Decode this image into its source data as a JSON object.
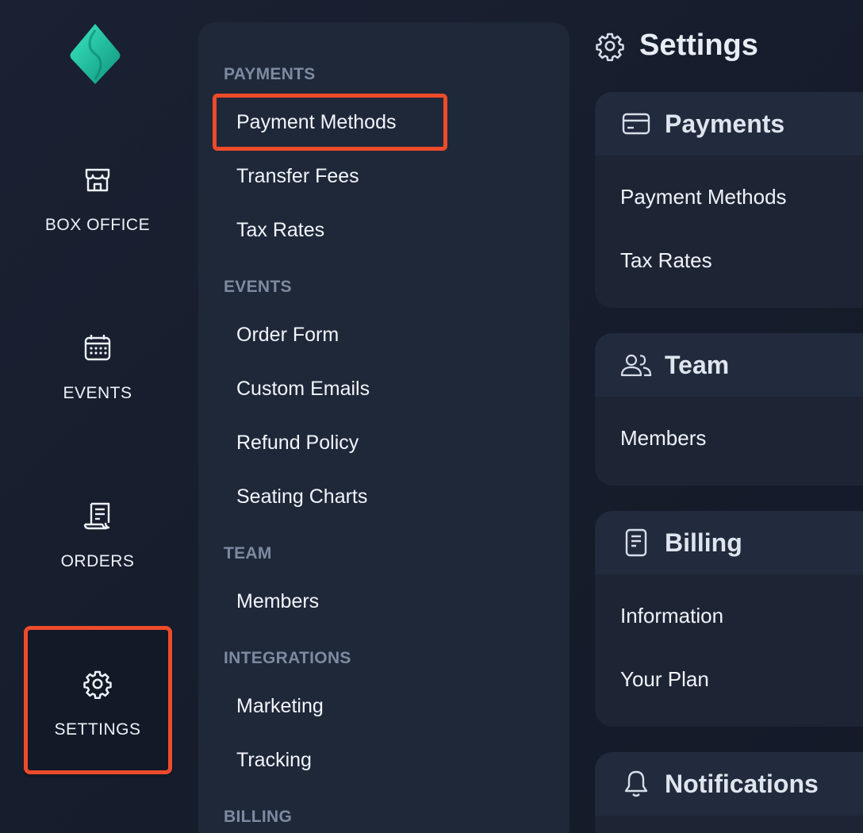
{
  "rail": {
    "items": [
      {
        "label": "BOX OFFICE",
        "icon": "storefront-icon"
      },
      {
        "label": "EVENTS",
        "icon": "calendar-icon"
      },
      {
        "label": "ORDERS",
        "icon": "receipt-icon"
      },
      {
        "label": "SETTINGS",
        "icon": "gear-icon"
      }
    ],
    "active": "SETTINGS"
  },
  "submenu": {
    "sections": [
      {
        "title": "PAYMENTS",
        "items": [
          "Payment Methods",
          "Transfer Fees",
          "Tax Rates"
        ]
      },
      {
        "title": "EVENTS",
        "items": [
          "Order Form",
          "Custom Emails",
          "Refund Policy",
          "Seating Charts"
        ]
      },
      {
        "title": "TEAM",
        "items": [
          "Members"
        ]
      },
      {
        "title": "INTEGRATIONS",
        "items": [
          "Marketing",
          "Tracking"
        ]
      },
      {
        "title": "BILLING",
        "items": []
      }
    ],
    "highlighted": "Payment Methods"
  },
  "main": {
    "title": "Settings",
    "cards": [
      {
        "title": "Payments",
        "icon": "credit-card-icon",
        "rows": [
          "Payment Methods",
          "Tax Rates"
        ]
      },
      {
        "title": "Team",
        "icon": "users-icon",
        "rows": [
          "Members"
        ]
      },
      {
        "title": "Billing",
        "icon": "document-icon",
        "rows": [
          "Information",
          "Your Plan"
        ]
      },
      {
        "title": "Notifications",
        "icon": "bell-icon",
        "rows": []
      }
    ]
  },
  "colors": {
    "highlight": "#ee4b2b",
    "logo_start": "#2fe0b4",
    "logo_end": "#0f9a86"
  }
}
